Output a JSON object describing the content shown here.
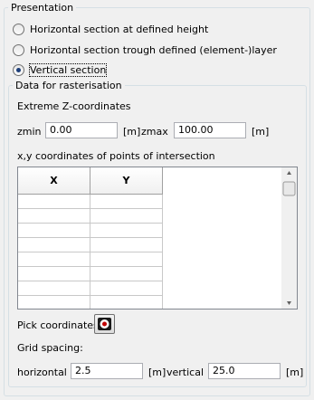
{
  "presentation": {
    "legend": "Presentation",
    "options": [
      {
        "label": "Horizontal section at defined height",
        "checked": false
      },
      {
        "label": "Horizontal section trough defined (element-)layer",
        "checked": false
      },
      {
        "label": "Vertical section",
        "checked": true
      }
    ]
  },
  "rasterisation": {
    "legend": "Data for rasterisation",
    "extreme_z_label": "Extreme Z-coordinates",
    "zmin_label": "zmin",
    "zmin_value": "0.00",
    "zmin_unit": "[m]",
    "zmax_label": "zmax",
    "zmax_value": "100.00",
    "zmax_unit": "[m]",
    "xy_label": "x,y coordinates of points of intersection",
    "table": {
      "columns": [
        "X",
        "Y"
      ],
      "row_count": 8
    },
    "pick_label": "Pick coordinates",
    "grid_spacing_label": "Grid spacing:",
    "horizontal_label": "horizontal",
    "horizontal_value": "2.5",
    "horizontal_unit": "[m]",
    "vertical_label": "vertical",
    "vertical_value": "25.0",
    "vertical_unit": "[m]"
  },
  "colors": {
    "group_border": "#d5dfe5",
    "radio_dot": "#1d3f7a",
    "pick_icon_ring": "#c00000"
  },
  "icons": {
    "pick": "target-icon",
    "scroll_up": "arrow-up-icon",
    "scroll_down": "arrow-down-icon"
  }
}
